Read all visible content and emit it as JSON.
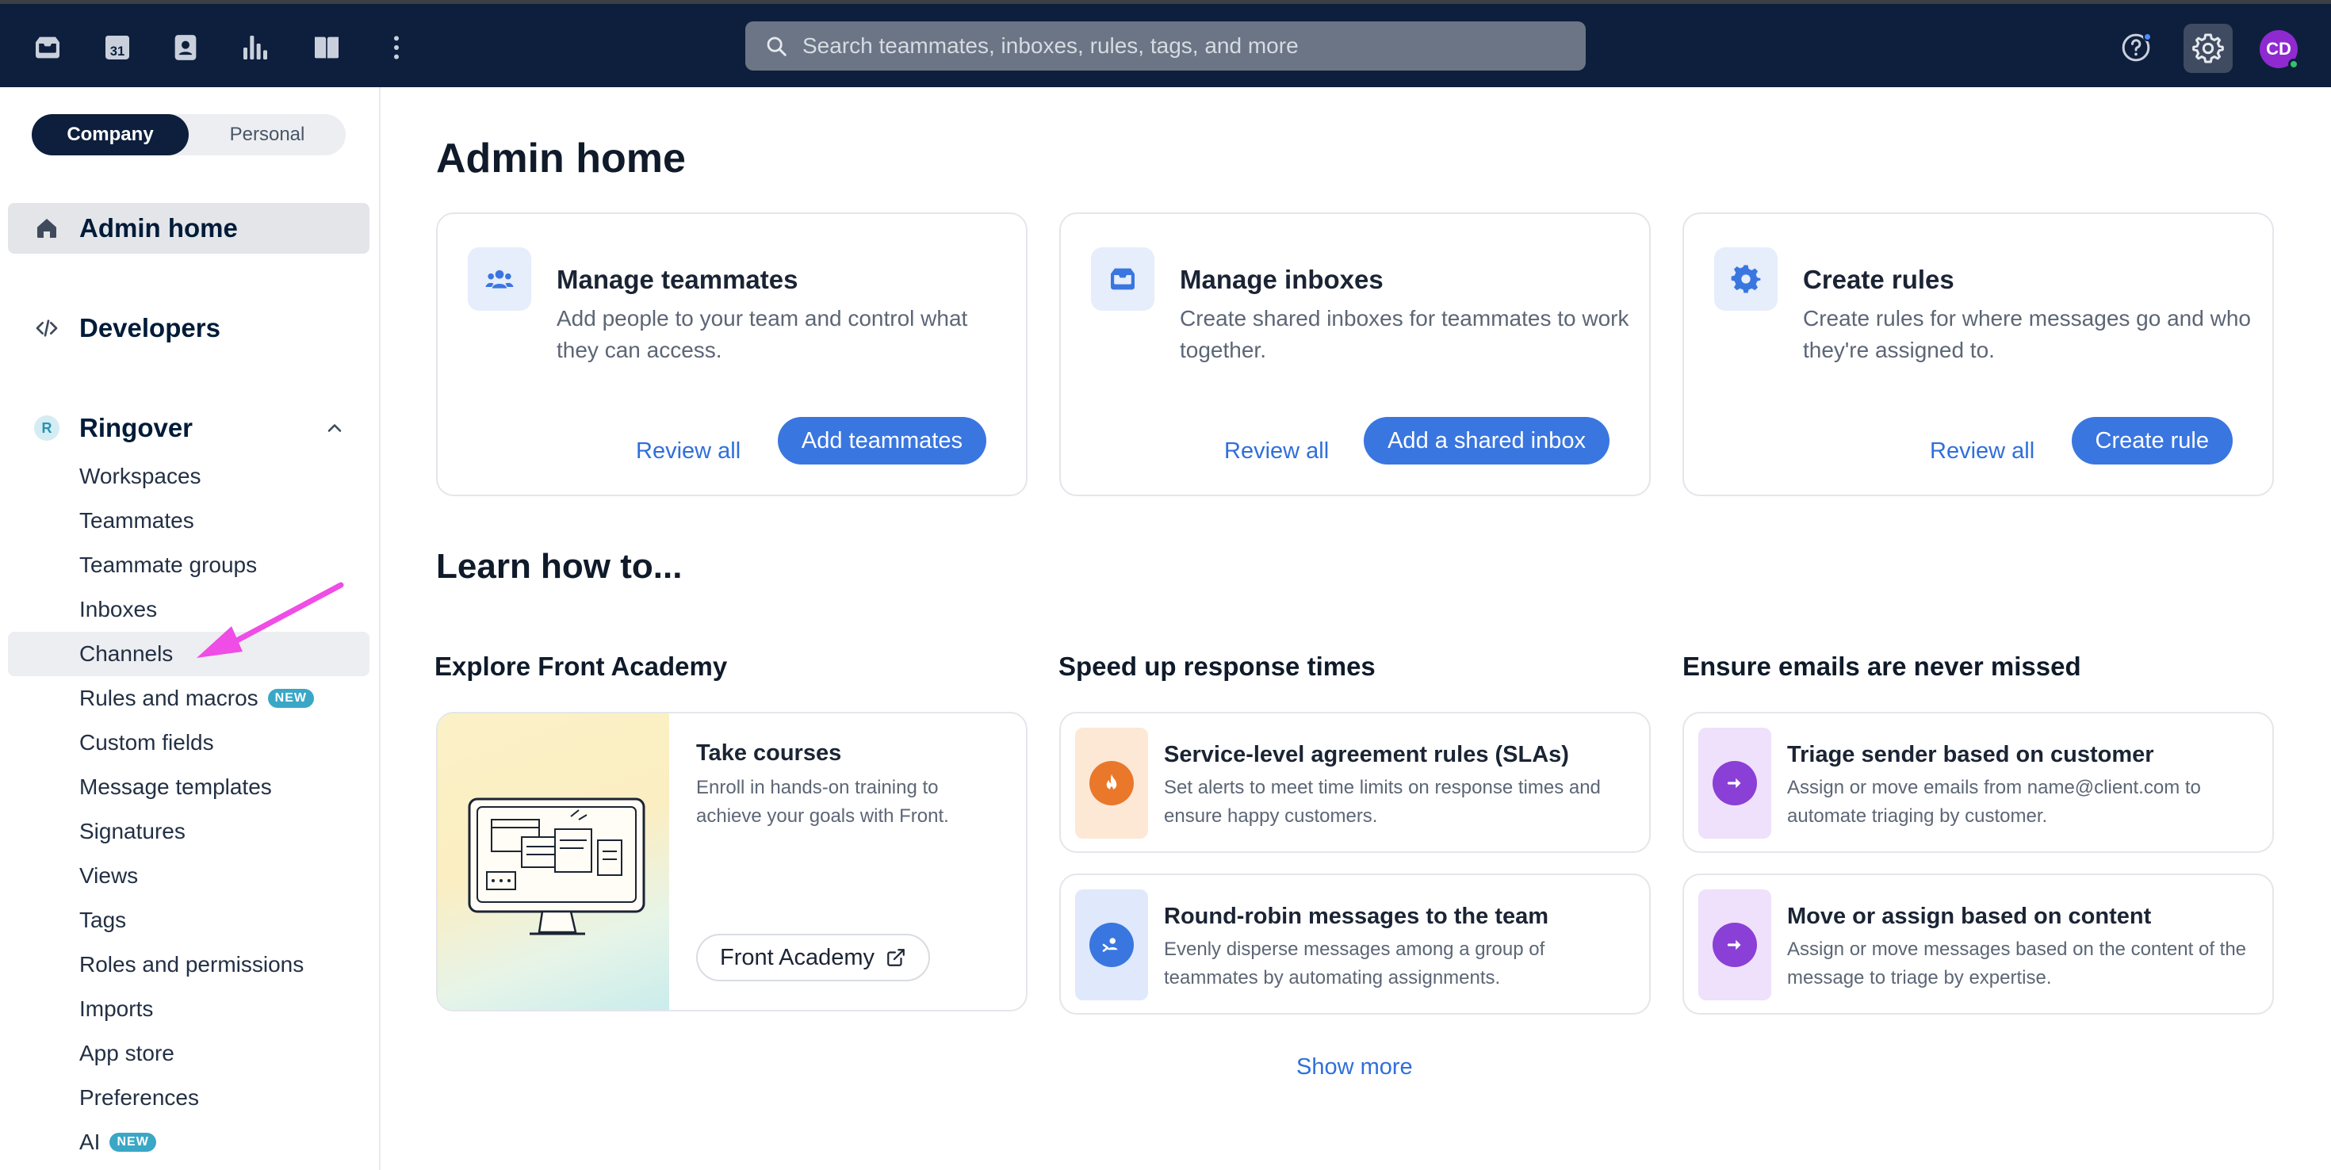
{
  "topbar": {
    "search_placeholder": "Search teammates, inboxes, rules, tags, and more",
    "calendar_day": "31",
    "avatar_initials": "CD",
    "icons": [
      "inbox-icon",
      "calendar-icon",
      "contacts-icon",
      "analytics-icon",
      "knowledge-base-icon",
      "more-icon",
      "help-icon",
      "settings-icon"
    ]
  },
  "sidebar": {
    "toggle": {
      "company": "Company",
      "personal": "Personal"
    },
    "admin_home": "Admin home",
    "developers": "Developers",
    "workspace": {
      "badge": "R",
      "name": "Ringover"
    },
    "items": [
      {
        "label": "Workspaces"
      },
      {
        "label": "Teammates"
      },
      {
        "label": "Teammate groups"
      },
      {
        "label": "Inboxes"
      },
      {
        "label": "Channels"
      },
      {
        "label": "Rules and macros",
        "badge": "NEW"
      },
      {
        "label": "Custom fields"
      },
      {
        "label": "Message templates"
      },
      {
        "label": "Signatures"
      },
      {
        "label": "Views"
      },
      {
        "label": "Tags"
      },
      {
        "label": "Roles and permissions"
      },
      {
        "label": "Imports"
      },
      {
        "label": "App store"
      },
      {
        "label": "Preferences"
      },
      {
        "label": "AI",
        "badge": "NEW"
      }
    ]
  },
  "main": {
    "title": "Admin home",
    "cards": [
      {
        "title": "Manage teammates",
        "desc": "Add people to your team and control what they can access.",
        "link": "Review all",
        "button": "Add teammates"
      },
      {
        "title": "Manage inboxes",
        "desc": "Create shared inboxes for teammates to work together.",
        "link": "Review all",
        "button": "Add a shared inbox"
      },
      {
        "title": "Create rules",
        "desc": "Create rules for where messages go and who they're assigned to.",
        "link": "Review all",
        "button": "Create rule"
      }
    ],
    "learn_title": "Learn how to...",
    "columns": [
      {
        "title": "Explore Front Academy"
      },
      {
        "title": "Speed up response times"
      },
      {
        "title": "Ensure emails are never missed"
      }
    ],
    "academy": {
      "title": "Take courses",
      "desc": "Enroll in hands-on training to achieve your goals with Front.",
      "button": "Front Academy"
    },
    "tips": [
      {
        "title": "Service-level agreement rules (SLAs)",
        "desc": "Set alerts to meet time limits on response times and ensure happy customers."
      },
      {
        "title": "Round-robin messages to the team",
        "desc": "Evenly disperse messages among a group of teammates by automating assignments."
      },
      {
        "title": "Triage sender based on customer",
        "desc": "Assign or move emails from name@client.com to automate triaging by customer."
      },
      {
        "title": "Move or assign based on content",
        "desc": "Assign or move messages based on the content of the message to triage by expertise."
      }
    ],
    "show_more": "Show more"
  },
  "colors": {
    "topbar_bg": "#0d1f3c",
    "accent_blue": "#3a76e0",
    "link_blue": "#2f6fda",
    "annotation_arrow": "#f04ce6",
    "avatar_purple": "#8f2ad1"
  }
}
